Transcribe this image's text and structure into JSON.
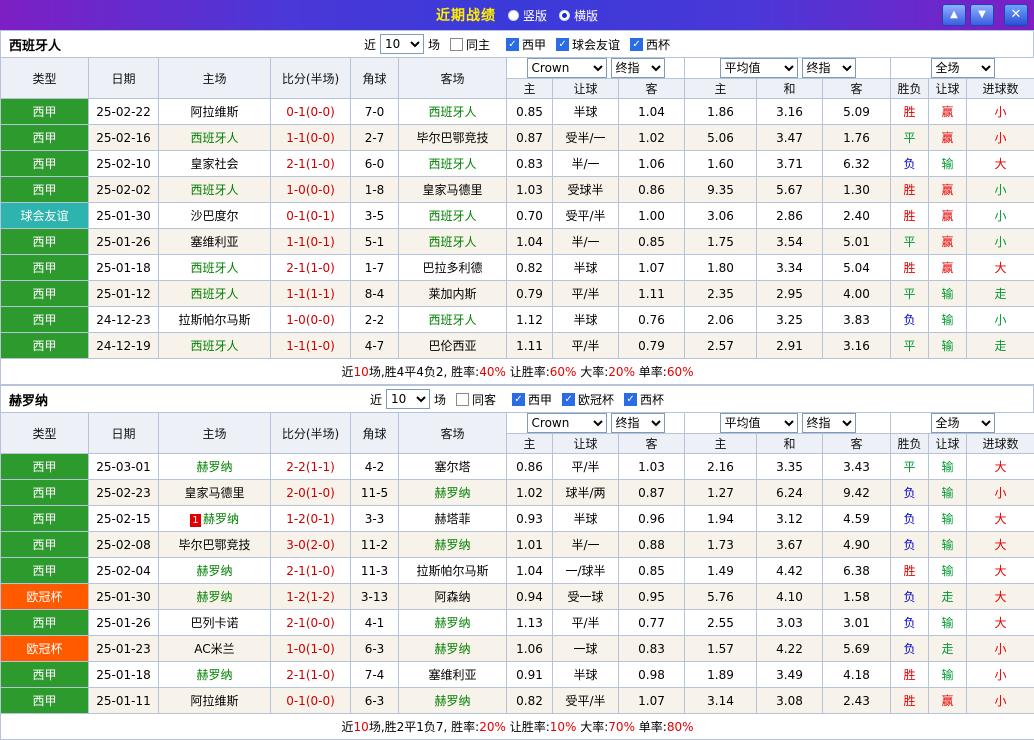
{
  "titlebar": {
    "title": "近期战绩",
    "radios": [
      {
        "label": "竖版",
        "selected": false
      },
      {
        "label": "横版",
        "selected": true
      }
    ],
    "icons": {
      "up": "▲",
      "down": "▼",
      "close": "✕"
    }
  },
  "columns_row1": [
    "类型",
    "日期",
    "主场",
    "比分(半场)",
    "角球",
    "客场"
  ],
  "columns_row2": [
    "主",
    "让球",
    "客",
    "主",
    "和",
    "客",
    "胜负",
    "让球",
    "进球数"
  ],
  "header_selects": {
    "odds_source": "Crown",
    "odds_stage": "终指",
    "avg_source": "平均值",
    "avg_stage": "终指",
    "scope": "全场"
  },
  "sections": [
    {
      "team": "西班牙人",
      "filter": {
        "near": "近",
        "count": "10",
        "games": "场",
        "checkboxes": [
          {
            "label": "同主",
            "checked": false
          },
          {
            "label": "西甲",
            "checked": true
          },
          {
            "label": "球会友谊",
            "checked": true
          },
          {
            "label": "西杯",
            "checked": true
          }
        ]
      },
      "rows": [
        {
          "league": "西甲",
          "league_type": "green",
          "date": "25-02-22",
          "home": "阿拉维斯",
          "home_focal": false,
          "score": "0-1(0-0)",
          "corner": "7-0",
          "away": "西班牙人",
          "away_focal": true,
          "odds": [
            "0.85",
            "半球",
            "1.04"
          ],
          "avg": [
            "1.86",
            "3.16",
            "5.09"
          ],
          "outcomes": [
            {
              "t": "胜",
              "c": "r"
            },
            {
              "t": "赢",
              "c": "r"
            },
            {
              "t": "小",
              "c": "r"
            }
          ]
        },
        {
          "league": "西甲",
          "league_type": "green",
          "date": "25-02-16",
          "home": "西班牙人",
          "home_focal": true,
          "score": "1-1(0-0)",
          "corner": "2-7",
          "away": "毕尔巴鄂竞技",
          "away_focal": false,
          "odds": [
            "0.87",
            "受半/一",
            "1.02"
          ],
          "avg": [
            "5.06",
            "3.47",
            "1.76"
          ],
          "outcomes": [
            {
              "t": "平",
              "c": "g"
            },
            {
              "t": "赢",
              "c": "r"
            },
            {
              "t": "小",
              "c": "r"
            }
          ]
        },
        {
          "league": "西甲",
          "league_type": "green",
          "date": "25-02-10",
          "home": "皇家社会",
          "home_focal": false,
          "score": "2-1(1-0)",
          "corner": "6-0",
          "away": "西班牙人",
          "away_focal": true,
          "odds": [
            "0.83",
            "半/一",
            "1.06"
          ],
          "avg": [
            "1.60",
            "3.71",
            "6.32"
          ],
          "outcomes": [
            {
              "t": "负",
              "c": "b"
            },
            {
              "t": "输",
              "c": "g"
            },
            {
              "t": "大",
              "c": "r"
            }
          ]
        },
        {
          "league": "西甲",
          "league_type": "green",
          "date": "25-02-02",
          "home": "西班牙人",
          "home_focal": true,
          "score": "1-0(0-0)",
          "corner": "1-8",
          "away": "皇家马德里",
          "away_focal": false,
          "odds": [
            "1.03",
            "受球半",
            "0.86"
          ],
          "avg": [
            "9.35",
            "5.67",
            "1.30"
          ],
          "outcomes": [
            {
              "t": "胜",
              "c": "r"
            },
            {
              "t": "赢",
              "c": "r"
            },
            {
              "t": "小",
              "c": "g"
            }
          ]
        },
        {
          "league": "球会友谊",
          "league_type": "teal",
          "date": "25-01-30",
          "home": "沙巴度尔",
          "home_focal": false,
          "score": "0-1(0-1)",
          "corner": "3-5",
          "away": "西班牙人",
          "away_focal": true,
          "odds": [
            "0.70",
            "受平/半",
            "1.00"
          ],
          "avg": [
            "3.06",
            "2.86",
            "2.40"
          ],
          "outcomes": [
            {
              "t": "胜",
              "c": "r"
            },
            {
              "t": "赢",
              "c": "r"
            },
            {
              "t": "小",
              "c": "g"
            }
          ]
        },
        {
          "league": "西甲",
          "league_type": "green",
          "date": "25-01-26",
          "home": "塞维利亚",
          "home_focal": false,
          "score": "1-1(0-1)",
          "corner": "5-1",
          "away": "西班牙人",
          "away_focal": true,
          "odds": [
            "1.04",
            "半/一",
            "0.85"
          ],
          "avg": [
            "1.75",
            "3.54",
            "5.01"
          ],
          "outcomes": [
            {
              "t": "平",
              "c": "g"
            },
            {
              "t": "赢",
              "c": "r"
            },
            {
              "t": "小",
              "c": "g"
            }
          ]
        },
        {
          "league": "西甲",
          "league_type": "green",
          "date": "25-01-18",
          "home": "西班牙人",
          "home_focal": true,
          "score": "2-1(1-0)",
          "corner": "1-7",
          "away": "巴拉多利德",
          "away_focal": false,
          "odds": [
            "0.82",
            "半球",
            "1.07"
          ],
          "avg": [
            "1.80",
            "3.34",
            "5.04"
          ],
          "outcomes": [
            {
              "t": "胜",
              "c": "r"
            },
            {
              "t": "赢",
              "c": "r"
            },
            {
              "t": "大",
              "c": "r"
            }
          ]
        },
        {
          "league": "西甲",
          "league_type": "green",
          "date": "25-01-12",
          "home": "西班牙人",
          "home_focal": true,
          "score": "1-1(1-1)",
          "corner": "8-4",
          "away": "莱加内斯",
          "away_focal": false,
          "odds": [
            "0.79",
            "平/半",
            "1.11"
          ],
          "avg": [
            "2.35",
            "2.95",
            "4.00"
          ],
          "outcomes": [
            {
              "t": "平",
              "c": "g"
            },
            {
              "t": "输",
              "c": "g"
            },
            {
              "t": "走",
              "c": "g"
            }
          ]
        },
        {
          "league": "西甲",
          "league_type": "green",
          "date": "24-12-23",
          "home": "拉斯帕尔马斯",
          "home_focal": false,
          "score": "1-0(0-0)",
          "corner": "2-2",
          "away": "西班牙人",
          "away_focal": true,
          "odds": [
            "1.12",
            "半球",
            "0.76"
          ],
          "avg": [
            "2.06",
            "3.25",
            "3.83"
          ],
          "outcomes": [
            {
              "t": "负",
              "c": "b"
            },
            {
              "t": "输",
              "c": "g"
            },
            {
              "t": "小",
              "c": "g"
            }
          ]
        },
        {
          "league": "西甲",
          "league_type": "green",
          "date": "24-12-19",
          "home": "西班牙人",
          "home_focal": true,
          "score": "1-1(1-0)",
          "corner": "4-7",
          "away": "巴伦西亚",
          "away_focal": false,
          "odds": [
            "1.11",
            "平/半",
            "0.79"
          ],
          "avg": [
            "2.57",
            "2.91",
            "3.16"
          ],
          "outcomes": [
            {
              "t": "平",
              "c": "g"
            },
            {
              "t": "输",
              "c": "g"
            },
            {
              "t": "走",
              "c": "g"
            }
          ]
        }
      ],
      "summary": [
        {
          "t": "近",
          "c": "k"
        },
        {
          "t": "10",
          "c": "r"
        },
        {
          "t": "场,胜4平4负2, 胜率:",
          "c": "k"
        },
        {
          "t": "40%",
          "c": "r"
        },
        {
          "t": " 让胜率:",
          "c": "k"
        },
        {
          "t": "60%",
          "c": "r"
        },
        {
          "t": " 大率:",
          "c": "k"
        },
        {
          "t": "20%",
          "c": "r"
        },
        {
          "t": " 单率:",
          "c": "k"
        },
        {
          "t": "60%",
          "c": "r"
        }
      ]
    },
    {
      "team": "赫罗纳",
      "filter": {
        "near": "近",
        "count": "10",
        "games": "场",
        "checkboxes": [
          {
            "label": "同客",
            "checked": false
          },
          {
            "label": "西甲",
            "checked": true
          },
          {
            "label": "欧冠杯",
            "checked": true
          },
          {
            "label": "西杯",
            "checked": true
          }
        ]
      },
      "rows": [
        {
          "league": "西甲",
          "league_type": "green",
          "date": "25-03-01",
          "home": "赫罗纳",
          "home_focal": true,
          "score": "2-2(1-1)",
          "corner": "4-2",
          "away": "塞尔塔",
          "away_focal": false,
          "odds": [
            "0.86",
            "平/半",
            "1.03"
          ],
          "avg": [
            "2.16",
            "3.35",
            "3.43"
          ],
          "outcomes": [
            {
              "t": "平",
              "c": "g"
            },
            {
              "t": "输",
              "c": "g"
            },
            {
              "t": "大",
              "c": "r"
            }
          ]
        },
        {
          "league": "西甲",
          "league_type": "green",
          "date": "25-02-23",
          "home": "皇家马德里",
          "home_focal": false,
          "score": "2-0(1-0)",
          "corner": "11-5",
          "away": "赫罗纳",
          "away_focal": true,
          "odds": [
            "1.02",
            "球半/两",
            "0.87"
          ],
          "avg": [
            "1.27",
            "6.24",
            "9.42"
          ],
          "outcomes": [
            {
              "t": "负",
              "c": "b"
            },
            {
              "t": "输",
              "c": "g"
            },
            {
              "t": "小",
              "c": "r"
            }
          ]
        },
        {
          "league": "西甲",
          "league_type": "green",
          "date": "25-02-15",
          "home": "赫罗纳",
          "home_focal": true,
          "home_badge": "1",
          "score": "1-2(0-1)",
          "corner": "3-3",
          "away": "赫塔菲",
          "away_focal": false,
          "odds": [
            "0.93",
            "半球",
            "0.96"
          ],
          "avg": [
            "1.94",
            "3.12",
            "4.59"
          ],
          "outcomes": [
            {
              "t": "负",
              "c": "b"
            },
            {
              "t": "输",
              "c": "g"
            },
            {
              "t": "大",
              "c": "r"
            }
          ]
        },
        {
          "league": "西甲",
          "league_type": "green",
          "date": "25-02-08",
          "home": "毕尔巴鄂竞技",
          "home_focal": false,
          "score": "3-0(2-0)",
          "corner": "11-2",
          "away": "赫罗纳",
          "away_focal": true,
          "odds": [
            "1.01",
            "半/一",
            "0.88"
          ],
          "avg": [
            "1.73",
            "3.67",
            "4.90"
          ],
          "outcomes": [
            {
              "t": "负",
              "c": "b"
            },
            {
              "t": "输",
              "c": "g"
            },
            {
              "t": "大",
              "c": "r"
            }
          ]
        },
        {
          "league": "西甲",
          "league_type": "green",
          "date": "25-02-04",
          "home": "赫罗纳",
          "home_focal": true,
          "score": "2-1(1-0)",
          "corner": "11-3",
          "away": "拉斯帕尔马斯",
          "away_focal": false,
          "odds": [
            "1.04",
            "一/球半",
            "0.85"
          ],
          "avg": [
            "1.49",
            "4.42",
            "6.38"
          ],
          "outcomes": [
            {
              "t": "胜",
              "c": "r"
            },
            {
              "t": "输",
              "c": "g"
            },
            {
              "t": "大",
              "c": "r"
            }
          ]
        },
        {
          "league": "欧冠杯",
          "league_type": "orange",
          "date": "25-01-30",
          "home": "赫罗纳",
          "home_focal": true,
          "score": "1-2(1-2)",
          "corner": "3-13",
          "away": "阿森纳",
          "away_focal": false,
          "odds": [
            "0.94",
            "受一球",
            "0.95"
          ],
          "avg": [
            "5.76",
            "4.10",
            "1.58"
          ],
          "outcomes": [
            {
              "t": "负",
              "c": "b"
            },
            {
              "t": "走",
              "c": "g"
            },
            {
              "t": "大",
              "c": "r"
            }
          ]
        },
        {
          "league": "西甲",
          "league_type": "green",
          "date": "25-01-26",
          "home": "巴列卡诺",
          "home_focal": false,
          "score": "2-1(0-0)",
          "corner": "4-1",
          "away": "赫罗纳",
          "away_focal": true,
          "odds": [
            "1.13",
            "平/半",
            "0.77"
          ],
          "avg": [
            "2.55",
            "3.03",
            "3.01"
          ],
          "outcomes": [
            {
              "t": "负",
              "c": "b"
            },
            {
              "t": "输",
              "c": "g"
            },
            {
              "t": "大",
              "c": "r"
            }
          ]
        },
        {
          "league": "欧冠杯",
          "league_type": "orange",
          "date": "25-01-23",
          "home": "AC米兰",
          "home_focal": false,
          "score": "1-0(1-0)",
          "corner": "6-3",
          "away": "赫罗纳",
          "away_focal": true,
          "odds": [
            "1.06",
            "一球",
            "0.83"
          ],
          "avg": [
            "1.57",
            "4.22",
            "5.69"
          ],
          "outcomes": [
            {
              "t": "负",
              "c": "b"
            },
            {
              "t": "走",
              "c": "g"
            },
            {
              "t": "小",
              "c": "r"
            }
          ]
        },
        {
          "league": "西甲",
          "league_type": "green",
          "date": "25-01-18",
          "home": "赫罗纳",
          "home_focal": true,
          "score": "2-1(1-0)",
          "corner": "7-4",
          "away": "塞维利亚",
          "away_focal": false,
          "odds": [
            "0.91",
            "半球",
            "0.98"
          ],
          "avg": [
            "1.89",
            "3.49",
            "4.18"
          ],
          "outcomes": [
            {
              "t": "胜",
              "c": "r"
            },
            {
              "t": "输",
              "c": "g"
            },
            {
              "t": "小",
              "c": "r"
            }
          ]
        },
        {
          "league": "西甲",
          "league_type": "green",
          "date": "25-01-11",
          "home": "阿拉维斯",
          "home_focal": false,
          "score": "0-1(0-0)",
          "corner": "6-3",
          "away": "赫罗纳",
          "away_focal": true,
          "odds": [
            "0.82",
            "受平/半",
            "1.07"
          ],
          "avg": [
            "3.14",
            "3.08",
            "2.43"
          ],
          "outcomes": [
            {
              "t": "胜",
              "c": "r"
            },
            {
              "t": "赢",
              "c": "r"
            },
            {
              "t": "小",
              "c": "r"
            }
          ]
        }
      ],
      "summary": [
        {
          "t": "近",
          "c": "k"
        },
        {
          "t": "10",
          "c": "r"
        },
        {
          "t": "场,胜2平1负7, 胜率:",
          "c": "k"
        },
        {
          "t": "20%",
          "c": "r"
        },
        {
          "t": " 让胜率:",
          "c": "k"
        },
        {
          "t": "10%",
          "c": "r"
        },
        {
          "t": " 大率:",
          "c": "k"
        },
        {
          "t": "70%",
          "c": "r"
        },
        {
          "t": " 单率:",
          "c": "k"
        },
        {
          "t": "80%",
          "c": "r"
        }
      ]
    }
  ]
}
